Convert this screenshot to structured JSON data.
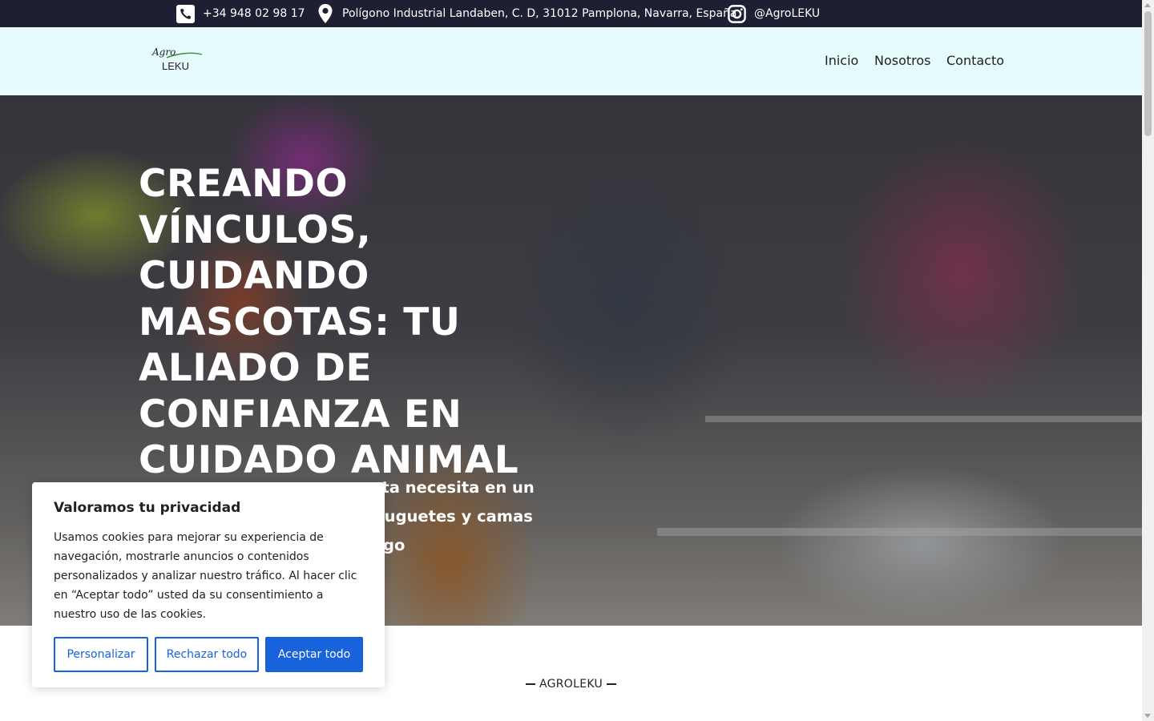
{
  "topbar": {
    "phone": "+34 948 02 98 17",
    "address": "Polígono Industrial Landaben, C. D, 31012 Pamplona, Navarra, España",
    "instagram": "@AgroLEKU",
    "icons": [
      "phone-icon",
      "location-pin-icon",
      "instagram-icon"
    ],
    "background": "#1f1f33"
  },
  "header": {
    "logo": {
      "top": "Agro",
      "bottom": "LEKU"
    },
    "nav": [
      "Inicio",
      "Nosotros",
      "Contacto"
    ],
    "background": "#e6fbfb"
  },
  "hero": {
    "title": "CREANDO VÍNCULOS, CUIDANDO MASCOTAS: TU ALIADO DE CONFIANZA EN CUIDADO ANIMAL",
    "subtitle_visible_lines": [
      "ota necesita en un",
      " juguetes y camas",
      "go"
    ]
  },
  "section": {
    "label": "AGROLEKU"
  },
  "cookie_banner": {
    "title": "Valoramos tu privacidad",
    "text": "Usamos cookies para mejorar su experiencia de navegación, mostrarle anuncios o contenidos personalizados y analizar nuestro tráfico. Al hacer clic en “Aceptar todo” usted da su consentimiento a nuestro uso de las cookies.",
    "buttons": {
      "customize": "Personalizar",
      "reject": "Rechazar todo",
      "accept": "Aceptar todo"
    },
    "accent": "#1863dc"
  }
}
